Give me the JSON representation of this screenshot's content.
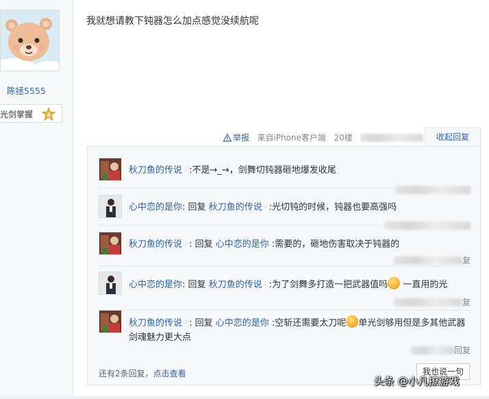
{
  "author": {
    "username": "陈拯5555",
    "rank_label": "光剑掌握",
    "rank_level": "4"
  },
  "post": {
    "text": "我就想请教下钝器怎么加点感觉没续航呢",
    "meta": {
      "report_label": "举报",
      "source": "来自iPhone客户端",
      "floor": "20楼"
    },
    "collapse_label": "收起回复"
  },
  "replies": [
    {
      "author": "秋刀鱼的传说",
      "reply_to": "",
      "content": ":不是→_→，剑舞切钝器砸地爆发收尾",
      "foot": ""
    },
    {
      "author": "心中恋的是你",
      "reply_prefix": "回复",
      "reply_to": "秋刀鱼的传说",
      "content": ":光切钝的时候，钝器也要高强吗",
      "foot": ""
    },
    {
      "author": "秋刀鱼的传说",
      "reply_prefix": "回复",
      "reply_to": "心中恋的是你",
      "content": ":需要的，砸地伤害取决于钝器的",
      "foot": "复"
    },
    {
      "author": "心中恋的是你",
      "reply_prefix": "回复",
      "reply_to": "秋刀鱼的传说",
      "content_a": ":为了剑舞多打造一把武器值吗",
      "content_b": "一直用的光",
      "foot": "复"
    },
    {
      "author": "秋刀鱼的传说",
      "reply_prefix": "回复",
      "reply_to": "心中恋的是你",
      "content_a": ":空斩还需要太刀呢",
      "content_b": "单光剑够用但是多其他武器剑魂魅力更大点",
      "foot": "回复"
    }
  ],
  "footer": {
    "more_prefix": "还有2条回复，",
    "more_link": "点击查看",
    "say_button": "我也说一句"
  },
  "watermark": "头条 @小凡撩游戏",
  "colors": {
    "link": "#2d64b3",
    "panel_bg": "#f7f8fa",
    "border": "#e3e3e3"
  }
}
